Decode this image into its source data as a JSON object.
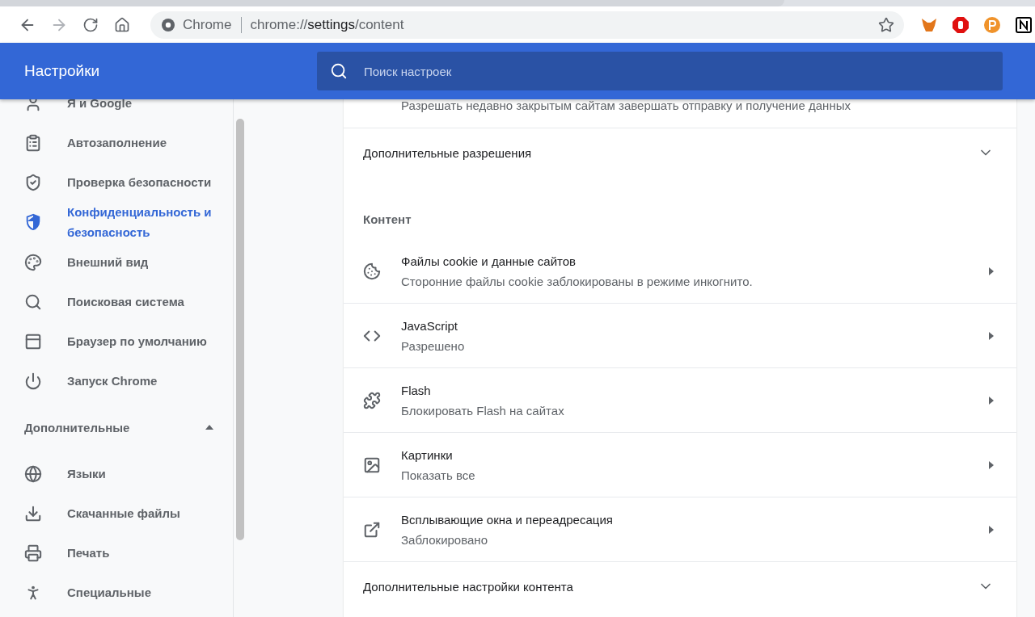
{
  "toolbar": {
    "site_label": "Chrome",
    "url_prefix": "chrome://",
    "url_host": "settings",
    "url_path": "/content"
  },
  "header": {
    "title": "Настройки",
    "search": {
      "placeholder": "Поиск настроек"
    }
  },
  "sidebar": {
    "items": [
      {
        "label": "Я и Google",
        "selected": false
      },
      {
        "label": "Автозаполнение",
        "selected": false
      },
      {
        "label": "Проверка безопасности",
        "selected": false
      },
      {
        "label": "Конфиденциальность и безопасность",
        "selected": true
      },
      {
        "label": "Внешний вид",
        "selected": false
      },
      {
        "label": "Поисковая система",
        "selected": false
      },
      {
        "label": "Браузер по умолчанию",
        "selected": false
      },
      {
        "label": "Запуск Chrome",
        "selected": false
      }
    ],
    "advanced": {
      "label": "Дополнительные",
      "expanded": true,
      "items": [
        {
          "label": "Языки",
          "selected": false
        },
        {
          "label": "Скачанные файлы",
          "selected": false
        },
        {
          "label": "Печать",
          "selected": false
        },
        {
          "label": "Специальные",
          "selected": false
        }
      ]
    }
  },
  "main": {
    "top_row": {
      "subtitle": "Разрешать недавно закрытым сайтам завершать отправку и получение данных"
    },
    "more_permissions": {
      "label": "Дополнительные разрешения",
      "expanded": false
    },
    "section_title": "Контент",
    "rows": [
      {
        "title": "Файлы cookie и данные сайтов",
        "subtitle": "Сторонние файлы cookie заблокированы в режиме инкогнито."
      },
      {
        "title": "JavaScript",
        "subtitle": "Разрешено"
      },
      {
        "title": "Flash",
        "subtitle": "Блокировать Flash на сайтах"
      },
      {
        "title": "Картинки",
        "subtitle": "Показать все"
      },
      {
        "title": "Всплывающие окна и переадресация",
        "subtitle": "Заблокировано"
      }
    ],
    "more_content": {
      "label": "Дополнительные настройки контента",
      "expanded": false
    }
  }
}
